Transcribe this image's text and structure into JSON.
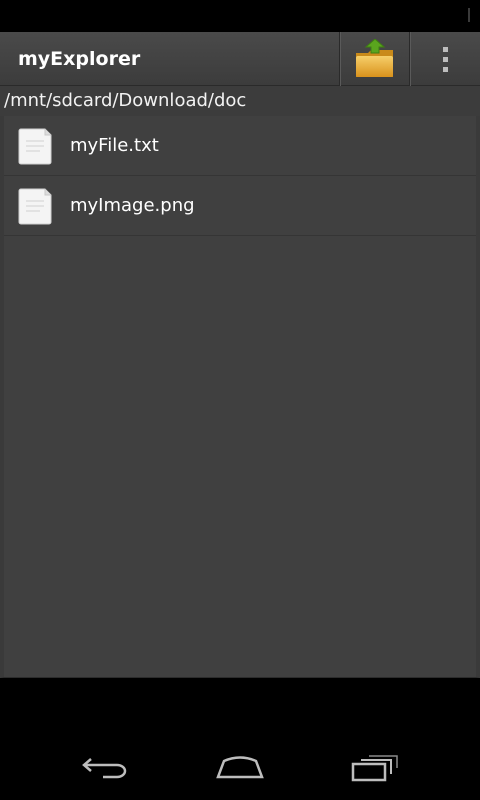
{
  "app": {
    "title": "myExplorer"
  },
  "toolbar": {
    "up_folder_icon": "folder-up-icon",
    "overflow_icon": "overflow-menu-icon"
  },
  "path": {
    "current": "/mnt/sdcard/Download/doc"
  },
  "files": [
    {
      "name": "myFile.txt",
      "icon": "document-icon"
    },
    {
      "name": "myImage.png",
      "icon": "document-icon"
    }
  ],
  "navigation": {
    "back_icon": "back-icon",
    "home_icon": "home-icon",
    "recents_icon": "recent-apps-icon"
  },
  "colors": {
    "action_bar": "#444444",
    "list_background": "#404040",
    "folder": "#e8a82e",
    "arrow": "#5aa51e"
  }
}
